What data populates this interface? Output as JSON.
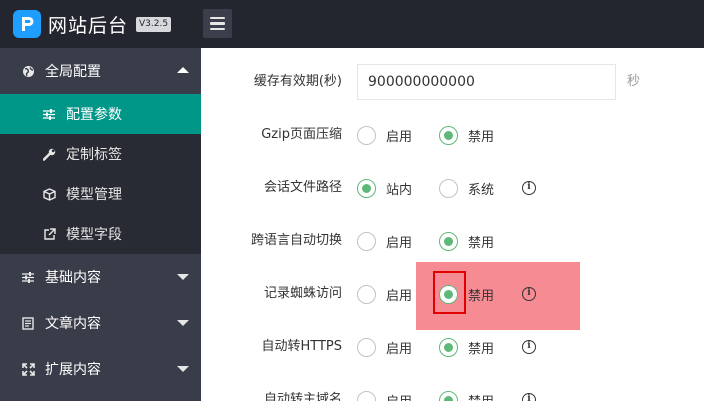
{
  "header": {
    "brand_title": "网站后台",
    "version": "V3.2.5"
  },
  "sidebar": {
    "groups": [
      {
        "label": "全局配置",
        "icon": "globe-icon",
        "expanded": true,
        "items": [
          {
            "label": "配置参数",
            "icon": "sliders-icon",
            "active": true
          },
          {
            "label": "定制标签",
            "icon": "wrench-icon",
            "active": false
          },
          {
            "label": "模型管理",
            "icon": "cube-icon",
            "active": false
          },
          {
            "label": "模型字段",
            "icon": "external-link-icon",
            "active": false
          }
        ]
      },
      {
        "label": "基础内容",
        "icon": "sliders-icon",
        "expanded": false
      },
      {
        "label": "文章内容",
        "icon": "document-icon",
        "expanded": false
      },
      {
        "label": "扩展内容",
        "icon": "expand-arrows-icon",
        "expanded": false
      }
    ]
  },
  "form": {
    "cache": {
      "label": "缓存有效期(秒)",
      "value": "900000000000",
      "unit": "秒"
    },
    "rows": [
      {
        "label": "Gzip页面压缩",
        "option1": "启用",
        "option2": "禁用",
        "selected": "option2",
        "info": false
      },
      {
        "label": "会话文件路径",
        "option1": "站内",
        "option2": "系统",
        "selected": "option1",
        "info": true
      },
      {
        "label": "跨语言自动切换",
        "option1": "启用",
        "option2": "禁用",
        "selected": "option2",
        "info": false
      },
      {
        "label": "记录蜘蛛访问",
        "option1": "启用",
        "option2": "禁用",
        "selected": "option2",
        "info": true
      },
      {
        "label": "自动转HTTPS",
        "option1": "启用",
        "option2": "禁用",
        "selected": "option2",
        "info": true
      },
      {
        "label": "自动转主域名",
        "option1": "启用",
        "option2": "禁用",
        "selected": "option2",
        "info": true
      }
    ]
  },
  "colors": {
    "header_bg": "#23262e",
    "sidebar_bg": "#393d49",
    "submenu_bg": "#282b33",
    "active_item": "#009688",
    "radio_checked": "#5fb878",
    "highlight": "#f46a75"
  }
}
